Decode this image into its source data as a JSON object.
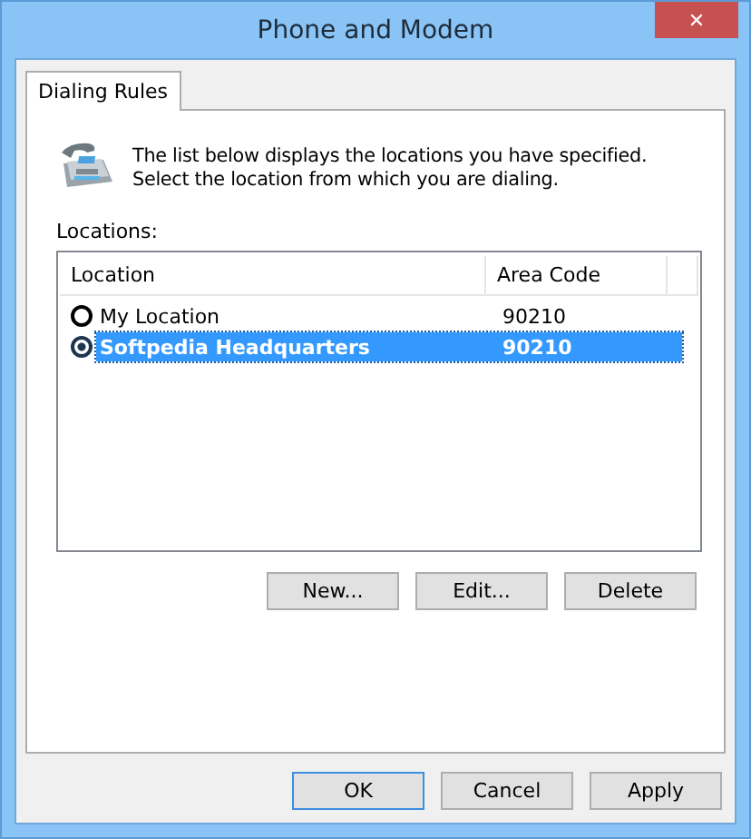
{
  "window": {
    "title": "Phone and Modem",
    "close": "✕"
  },
  "tabs": [
    {
      "label": "Dialing Rules",
      "selected": true
    }
  ],
  "description": "The list below displays the locations you have specified. Select the location from which you are dialing.",
  "locations_label": "Locations:",
  "table": {
    "columns": [
      "Location",
      "Area Code"
    ],
    "rows": [
      {
        "location": "My Location",
        "area_code": "90210",
        "selected": false
      },
      {
        "location": "Softpedia Headquarters",
        "area_code": "90210",
        "selected": true
      }
    ]
  },
  "list_buttons": [
    "New...",
    "Edit...",
    "Delete"
  ],
  "dialog_buttons": [
    {
      "label": "OK",
      "default": true
    },
    {
      "label": "Cancel",
      "default": false
    },
    {
      "label": "Apply",
      "default": false
    }
  ]
}
